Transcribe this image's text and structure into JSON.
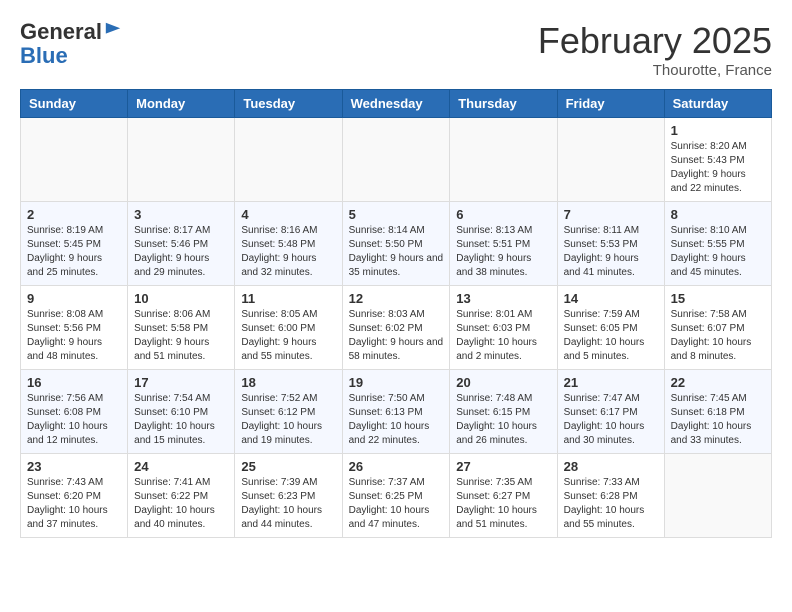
{
  "header": {
    "logo_general": "General",
    "logo_blue": "Blue",
    "title": "February 2025",
    "subtitle": "Thourotte, France"
  },
  "days_of_week": [
    "Sunday",
    "Monday",
    "Tuesday",
    "Wednesday",
    "Thursday",
    "Friday",
    "Saturday"
  ],
  "weeks": [
    [
      {
        "day": "",
        "info": ""
      },
      {
        "day": "",
        "info": ""
      },
      {
        "day": "",
        "info": ""
      },
      {
        "day": "",
        "info": ""
      },
      {
        "day": "",
        "info": ""
      },
      {
        "day": "",
        "info": ""
      },
      {
        "day": "1",
        "info": "Sunrise: 8:20 AM\nSunset: 5:43 PM\nDaylight: 9 hours and 22 minutes."
      }
    ],
    [
      {
        "day": "2",
        "info": "Sunrise: 8:19 AM\nSunset: 5:45 PM\nDaylight: 9 hours and 25 minutes."
      },
      {
        "day": "3",
        "info": "Sunrise: 8:17 AM\nSunset: 5:46 PM\nDaylight: 9 hours and 29 minutes."
      },
      {
        "day": "4",
        "info": "Sunrise: 8:16 AM\nSunset: 5:48 PM\nDaylight: 9 hours and 32 minutes."
      },
      {
        "day": "5",
        "info": "Sunrise: 8:14 AM\nSunset: 5:50 PM\nDaylight: 9 hours and 35 minutes."
      },
      {
        "day": "6",
        "info": "Sunrise: 8:13 AM\nSunset: 5:51 PM\nDaylight: 9 hours and 38 minutes."
      },
      {
        "day": "7",
        "info": "Sunrise: 8:11 AM\nSunset: 5:53 PM\nDaylight: 9 hours and 41 minutes."
      },
      {
        "day": "8",
        "info": "Sunrise: 8:10 AM\nSunset: 5:55 PM\nDaylight: 9 hours and 45 minutes."
      }
    ],
    [
      {
        "day": "9",
        "info": "Sunrise: 8:08 AM\nSunset: 5:56 PM\nDaylight: 9 hours and 48 minutes."
      },
      {
        "day": "10",
        "info": "Sunrise: 8:06 AM\nSunset: 5:58 PM\nDaylight: 9 hours and 51 minutes."
      },
      {
        "day": "11",
        "info": "Sunrise: 8:05 AM\nSunset: 6:00 PM\nDaylight: 9 hours and 55 minutes."
      },
      {
        "day": "12",
        "info": "Sunrise: 8:03 AM\nSunset: 6:02 PM\nDaylight: 9 hours and 58 minutes."
      },
      {
        "day": "13",
        "info": "Sunrise: 8:01 AM\nSunset: 6:03 PM\nDaylight: 10 hours and 2 minutes."
      },
      {
        "day": "14",
        "info": "Sunrise: 7:59 AM\nSunset: 6:05 PM\nDaylight: 10 hours and 5 minutes."
      },
      {
        "day": "15",
        "info": "Sunrise: 7:58 AM\nSunset: 6:07 PM\nDaylight: 10 hours and 8 minutes."
      }
    ],
    [
      {
        "day": "16",
        "info": "Sunrise: 7:56 AM\nSunset: 6:08 PM\nDaylight: 10 hours and 12 minutes."
      },
      {
        "day": "17",
        "info": "Sunrise: 7:54 AM\nSunset: 6:10 PM\nDaylight: 10 hours and 15 minutes."
      },
      {
        "day": "18",
        "info": "Sunrise: 7:52 AM\nSunset: 6:12 PM\nDaylight: 10 hours and 19 minutes."
      },
      {
        "day": "19",
        "info": "Sunrise: 7:50 AM\nSunset: 6:13 PM\nDaylight: 10 hours and 22 minutes."
      },
      {
        "day": "20",
        "info": "Sunrise: 7:48 AM\nSunset: 6:15 PM\nDaylight: 10 hours and 26 minutes."
      },
      {
        "day": "21",
        "info": "Sunrise: 7:47 AM\nSunset: 6:17 PM\nDaylight: 10 hours and 30 minutes."
      },
      {
        "day": "22",
        "info": "Sunrise: 7:45 AM\nSunset: 6:18 PM\nDaylight: 10 hours and 33 minutes."
      }
    ],
    [
      {
        "day": "23",
        "info": "Sunrise: 7:43 AM\nSunset: 6:20 PM\nDaylight: 10 hours and 37 minutes."
      },
      {
        "day": "24",
        "info": "Sunrise: 7:41 AM\nSunset: 6:22 PM\nDaylight: 10 hours and 40 minutes."
      },
      {
        "day": "25",
        "info": "Sunrise: 7:39 AM\nSunset: 6:23 PM\nDaylight: 10 hours and 44 minutes."
      },
      {
        "day": "26",
        "info": "Sunrise: 7:37 AM\nSunset: 6:25 PM\nDaylight: 10 hours and 47 minutes."
      },
      {
        "day": "27",
        "info": "Sunrise: 7:35 AM\nSunset: 6:27 PM\nDaylight: 10 hours and 51 minutes."
      },
      {
        "day": "28",
        "info": "Sunrise: 7:33 AM\nSunset: 6:28 PM\nDaylight: 10 hours and 55 minutes."
      },
      {
        "day": "",
        "info": ""
      }
    ]
  ]
}
